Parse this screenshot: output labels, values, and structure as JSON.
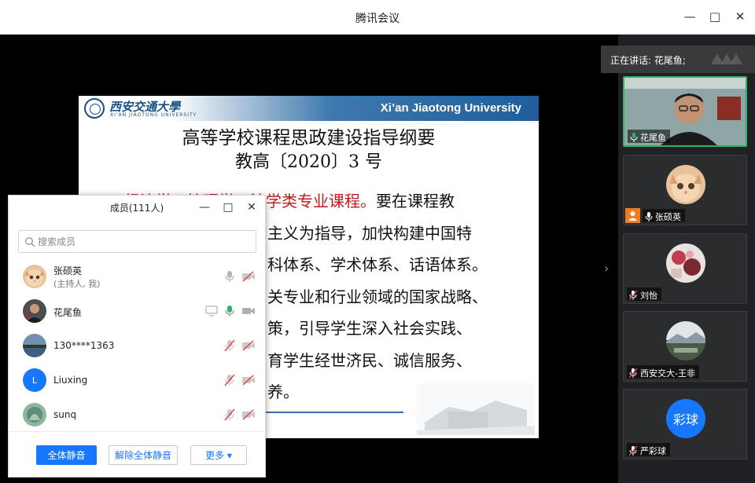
{
  "window": {
    "title": "腾讯会议"
  },
  "slide": {
    "university_cn": "西安交通大學",
    "university_sub": "XI'AN JIAOTONG UNIVERSITY",
    "university_en": "Xi’an Jiaotong University",
    "title_line1": "高等学校课程思政建设指导纲要",
    "title_line2": "教高〔2020〕3 号",
    "body": {
      "line1_red": "经济学、管理学、法学类专业课程。",
      "line1_rest": "要在课程教",
      "lines": [
        "主义为指导，加快构建中国特",
        "科体系、学术体系、话语体系。",
        "关专业和行业领域的国家战略、",
        "策，引导学生深入社会实践、",
        "育学生经世济民、诚信服务、",
        "养。"
      ]
    }
  },
  "members_panel": {
    "title": "成员(111人)",
    "search_placeholder": "搜索成员",
    "members": [
      {
        "name": "张硕英",
        "role": "(主持人, 我)",
        "avatar": "cat-avatar"
      },
      {
        "name": "花尾鱼",
        "role": "",
        "avatar": "person-avatar"
      },
      {
        "name": "130****1363",
        "role": "",
        "avatar": "lake-avatar"
      },
      {
        "name": "Liuxing",
        "role": "",
        "avatar": "letter-avatar",
        "letter": "L"
      },
      {
        "name": "sunq",
        "role": "",
        "avatar": "nature-avatar"
      }
    ],
    "buttons": {
      "mute_all": "全体静音",
      "unmute_all": "解除全体静音",
      "more": "更多 ▾"
    }
  },
  "sidebar": {
    "speaking_label": "正在讲话: 花尾鱼;",
    "participants": [
      {
        "name": "花尾鱼",
        "mic": "on",
        "video": true
      },
      {
        "name": "张硕英",
        "mic": "on",
        "host": true
      },
      {
        "name": "刘怡",
        "mic": "muted"
      },
      {
        "name": "西安交大-王非",
        "mic": "muted"
      },
      {
        "name": "严彩球",
        "mic": "muted",
        "avatar_text": "彩球"
      }
    ]
  },
  "colors": {
    "accent": "#1677ff",
    "active_speaker": "#2fb36b",
    "muted_red": "#e0443e",
    "slide_red": "#c0191b",
    "slide_blue": "#1f5e99"
  }
}
